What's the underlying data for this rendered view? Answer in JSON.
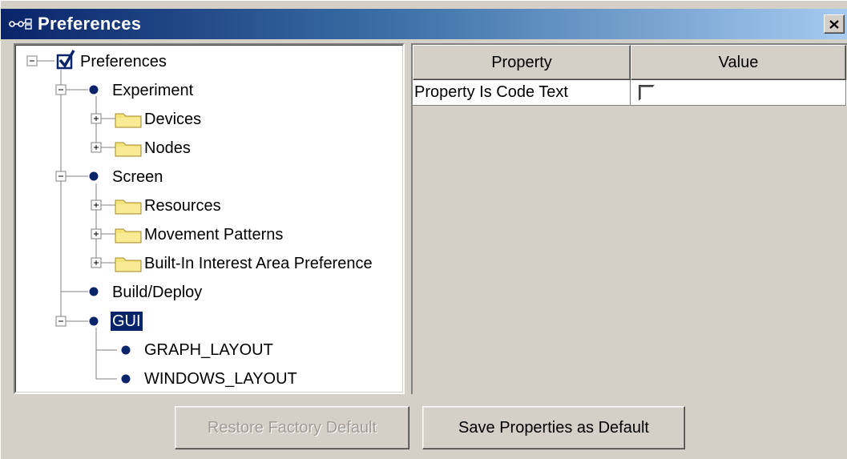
{
  "window": {
    "title": "Preferences",
    "close_label": "x"
  },
  "tree": {
    "nodes": [
      {
        "label": "Preferences",
        "icon": "checkbox-icon",
        "expander": "minus"
      },
      {
        "label": "Experiment",
        "icon": "bullet-icon",
        "expander": "minus"
      },
      {
        "label": "Devices",
        "icon": "folder-icon",
        "expander": "plus"
      },
      {
        "label": "Nodes",
        "icon": "folder-icon",
        "expander": "plus"
      },
      {
        "label": "Screen",
        "icon": "bullet-icon",
        "expander": "minus"
      },
      {
        "label": "Resources",
        "icon": "folder-icon",
        "expander": "plus"
      },
      {
        "label": "Movement Patterns",
        "icon": "folder-icon",
        "expander": "plus"
      },
      {
        "label": "Built-In Interest Area Preference",
        "icon": "folder-icon",
        "expander": "plus"
      },
      {
        "label": "Build/Deploy",
        "icon": "bullet-icon",
        "expander": "none"
      },
      {
        "label": "GUI",
        "icon": "bullet-icon",
        "expander": "minus",
        "selected": true
      },
      {
        "label": "GRAPH_LAYOUT",
        "icon": "bullet-icon",
        "expander": "none"
      },
      {
        "label": "WINDOWS_LAYOUT",
        "icon": "bullet-icon",
        "expander": "none"
      }
    ]
  },
  "property_table": {
    "columns": [
      "Property",
      "Value"
    ],
    "rows": [
      {
        "property": "Property Is Code Text",
        "value_checked": false
      }
    ]
  },
  "buttons": {
    "restore_label": "Restore Factory Default",
    "save_label": "Save Properties as Default"
  },
  "colors": {
    "selection": "#0a246a",
    "bullet": "#0a246a",
    "folder": "#f4e27a"
  }
}
